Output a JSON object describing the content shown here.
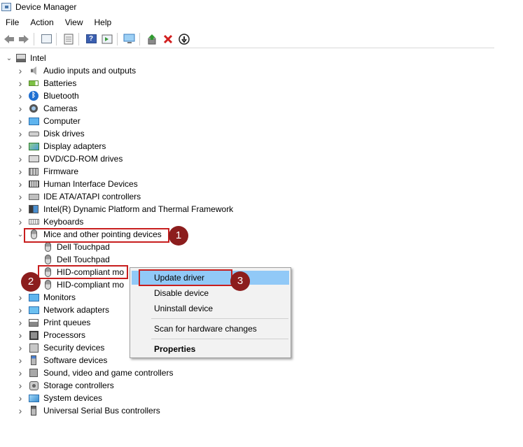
{
  "window": {
    "title": "Device Manager",
    "icon": "device-manager-icon"
  },
  "menubar": [
    "File",
    "Action",
    "View",
    "Help"
  ],
  "toolbar": [
    {
      "icon": "back-arrow-icon"
    },
    {
      "icon": "forward-arrow-icon"
    },
    {
      "icon": "show-hide-console-tree-icon"
    },
    {
      "icon": "properties-icon"
    },
    {
      "icon": "help-icon"
    },
    {
      "icon": "action-pane-icon"
    },
    {
      "icon": "scan-hardware-changes-icon"
    },
    {
      "icon": "update-driver-icon"
    },
    {
      "icon": "uninstall-device-icon"
    },
    {
      "icon": "disable-device-icon"
    }
  ],
  "tree": {
    "root": "Intel",
    "categories": [
      {
        "label": "Audio inputs and outputs",
        "icon": "speaker-icon"
      },
      {
        "label": "Batteries",
        "icon": "battery-icon"
      },
      {
        "label": "Bluetooth",
        "icon": "bluetooth-icon"
      },
      {
        "label": "Cameras",
        "icon": "camera-icon"
      },
      {
        "label": "Computer",
        "icon": "computer-icon"
      },
      {
        "label": "Disk drives",
        "icon": "disk-drive-icon"
      },
      {
        "label": "Display adapters",
        "icon": "display-adapter-icon"
      },
      {
        "label": "DVD/CD-ROM drives",
        "icon": "dvd-drive-icon"
      },
      {
        "label": "Firmware",
        "icon": "firmware-icon"
      },
      {
        "label": "Human Interface Devices",
        "icon": "hid-icon"
      },
      {
        "label": "IDE ATA/ATAPI controllers",
        "icon": "ide-controller-icon"
      },
      {
        "label": "Intel(R) Dynamic Platform and Thermal Framework",
        "icon": "intel-dptf-icon"
      },
      {
        "label": "Keyboards",
        "icon": "keyboard-icon"
      },
      {
        "label": "Mice and other pointing devices",
        "icon": "mouse-icon",
        "expanded": true
      },
      {
        "label": "Monitors",
        "icon": "monitor-icon"
      },
      {
        "label": "Network adapters",
        "icon": "network-adapter-icon"
      },
      {
        "label": "Print queues",
        "icon": "printer-icon"
      },
      {
        "label": "Processors",
        "icon": "processor-icon"
      },
      {
        "label": "Security devices",
        "icon": "security-device-icon"
      },
      {
        "label": "Software devices",
        "icon": "software-device-icon"
      },
      {
        "label": "Sound, video and game controllers",
        "icon": "sound-controller-icon"
      },
      {
        "label": "Storage controllers",
        "icon": "storage-controller-icon"
      },
      {
        "label": "System devices",
        "icon": "system-device-icon"
      },
      {
        "label": "Universal Serial Bus controllers",
        "icon": "usb-controller-icon"
      }
    ],
    "mice_children": [
      "Dell Touchpad",
      "Dell Touchpad",
      "HID-compliant mo",
      "HID-compliant mo"
    ]
  },
  "context_menu": {
    "items": [
      "Update driver",
      "Disable device",
      "Uninstall device",
      "Scan for hardware changes",
      "Properties"
    ],
    "active": "Update driver"
  },
  "badges": [
    "1",
    "2",
    "3"
  ],
  "colors": {
    "annotation_red": "#c81e1e",
    "badge": "#8c1d1d",
    "menu_highlight": "#91c9f7"
  }
}
